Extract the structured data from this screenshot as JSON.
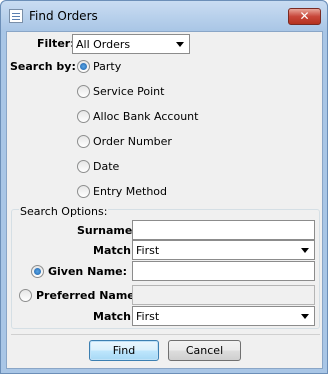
{
  "window": {
    "title": "Find Orders",
    "close_label": "✕"
  },
  "filter": {
    "label": "Filter:",
    "value": "All Orders"
  },
  "search_by": {
    "label": "Search by:",
    "options": [
      "Party",
      "Service Point",
      "Alloc Bank Account",
      "Order Number",
      "Date",
      "Entry Method"
    ],
    "selected": "Party"
  },
  "search_options": {
    "title": "Search Options:",
    "surname_label": "Surname:",
    "surname_value": "",
    "match1_label": "Match:",
    "match1_value": "First",
    "given_name_label": "Given Name:",
    "given_name_value": "",
    "preferred_name_label": "Preferred Name:",
    "preferred_name_value": "",
    "match2_label": "Match:",
    "match2_value": "First",
    "selected": "Given Name"
  },
  "buttons": {
    "find": "Find",
    "cancel": "Cancel"
  }
}
